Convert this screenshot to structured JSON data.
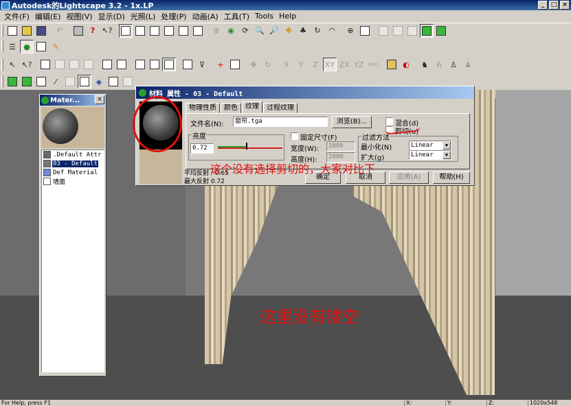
{
  "window": {
    "title": "Autodesk的Lightscape 3.2  - 1x.LP"
  },
  "menu": [
    "文件(F)",
    "编辑(E)",
    "视图(V)",
    "显示(D)",
    "光照(L)",
    "处理(P)",
    "动画(A)",
    "工具(T)",
    "Tools",
    "Help"
  ],
  "toolbar": {
    "axis_labels": [
      "X",
      "Y",
      "Z",
      "XY",
      "ZX",
      "YZ",
      "Aim"
    ]
  },
  "materials_window": {
    "title": "Mater...",
    "items": [
      {
        "label": ".Default Attr",
        "swatch": "#6a6a6a"
      },
      {
        "label": "03 - Default",
        "swatch": "#777777",
        "selected": true
      },
      {
        "label": "Def Material",
        "swatch": "#6c8cd8"
      },
      {
        "label": "墙面",
        "swatch": "#ffffff"
      }
    ]
  },
  "dialog": {
    "title": "材料 属性 - 03 - Default",
    "tabs": [
      "物理性质",
      "颜色",
      "纹理",
      "过程纹理"
    ],
    "active_tab": 2,
    "filename_label": "文件名(N):",
    "filename_value": "窗帘.tga",
    "browse_label": "浏览(B)...",
    "blend_label": "混合(d)",
    "clip_label": "剪切(u)",
    "brightness_group": "亮度",
    "brightness_value": "0.72",
    "fixed_size_label": "固定尺寸(F)",
    "width_label": "宽度(W):",
    "width_value": "1000",
    "height_label": "高度(H):",
    "height_value": "1000",
    "filter_group": "过滤方法",
    "minify_label": "最小化(N)",
    "minify_value": "Linear",
    "magnify_label": "扩大(g)",
    "magnify_value": "Linear",
    "avg_reflect": "平均反射 : 0.65",
    "max_reflect": "最大反射 0.72",
    "ok_label": "确定",
    "cancel_label": "取消",
    "apply_label": "应用(A)",
    "help_label": "帮助(H)"
  },
  "annotations": {
    "compare_note": "这个没有选择剪切的，大家对比下",
    "hollow_note": "这里没有镂空"
  },
  "status": {
    "help_text": "For Help, press F1",
    "x_label": "X:",
    "y_label": "Y:",
    "z_label": "Z:",
    "resolution": "1020x548"
  },
  "colors": {
    "titlebar": "#0a246a",
    "annotation": "#e01010",
    "viewport": "#7a7a7a"
  }
}
